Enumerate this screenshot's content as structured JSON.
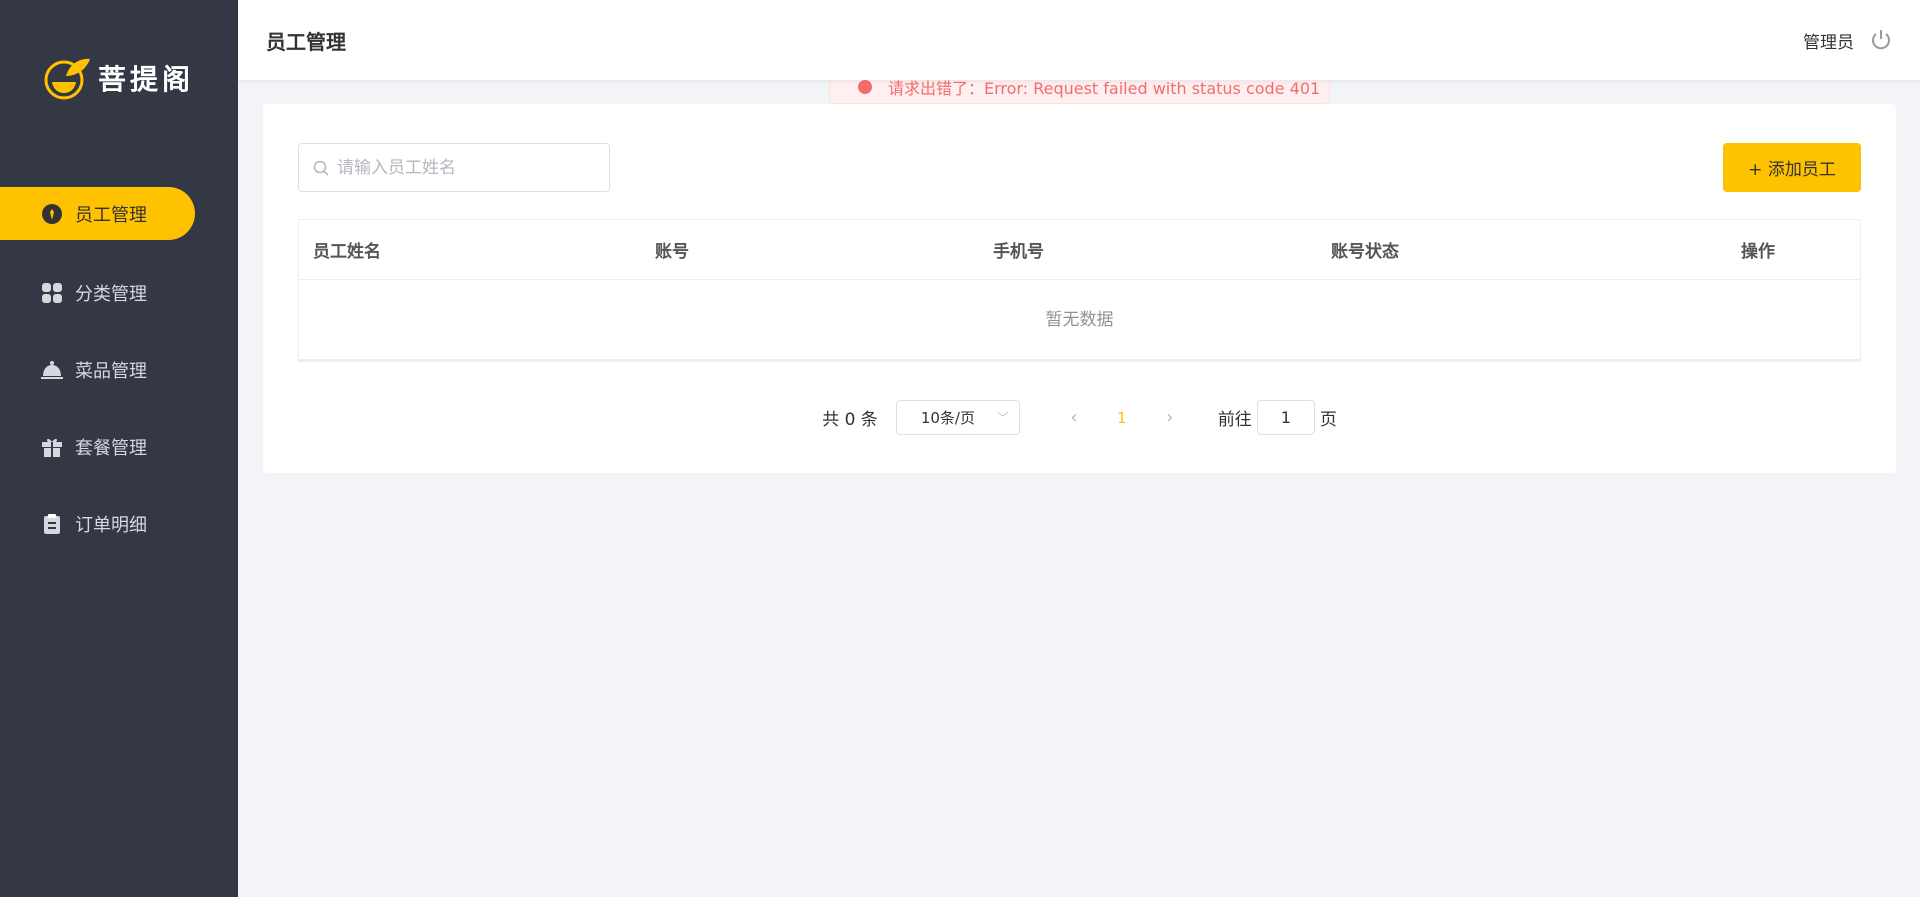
{
  "sidebar": {
    "brand": "菩提阁",
    "items": [
      {
        "label": "员工管理",
        "icon": "employee-icon"
      },
      {
        "label": "分类管理",
        "icon": "category-icon"
      },
      {
        "label": "菜品管理",
        "icon": "dish-icon"
      },
      {
        "label": "套餐管理",
        "icon": "gift-icon"
      },
      {
        "label": "订单明细",
        "icon": "clipboard-icon"
      }
    ]
  },
  "header": {
    "title": "员工管理",
    "user": "管理员"
  },
  "alert": {
    "message": "请求出错了：Error: Request failed with status code 401"
  },
  "toolbar": {
    "search_placeholder": "请输入员工姓名",
    "add_label": "+ 添加员工"
  },
  "table": {
    "columns": [
      "员工姓名",
      "账号",
      "手机号",
      "账号状态",
      "操作"
    ],
    "empty": "暂无数据"
  },
  "pagination": {
    "total": "共 0 条",
    "page_size": "10条/页",
    "current": "1",
    "goto_prefix": "前往",
    "goto_value": "1",
    "goto_suffix": "页"
  },
  "colors": {
    "accent": "#ffc200",
    "sidebar": "#343744",
    "error": "#f56c6c"
  }
}
